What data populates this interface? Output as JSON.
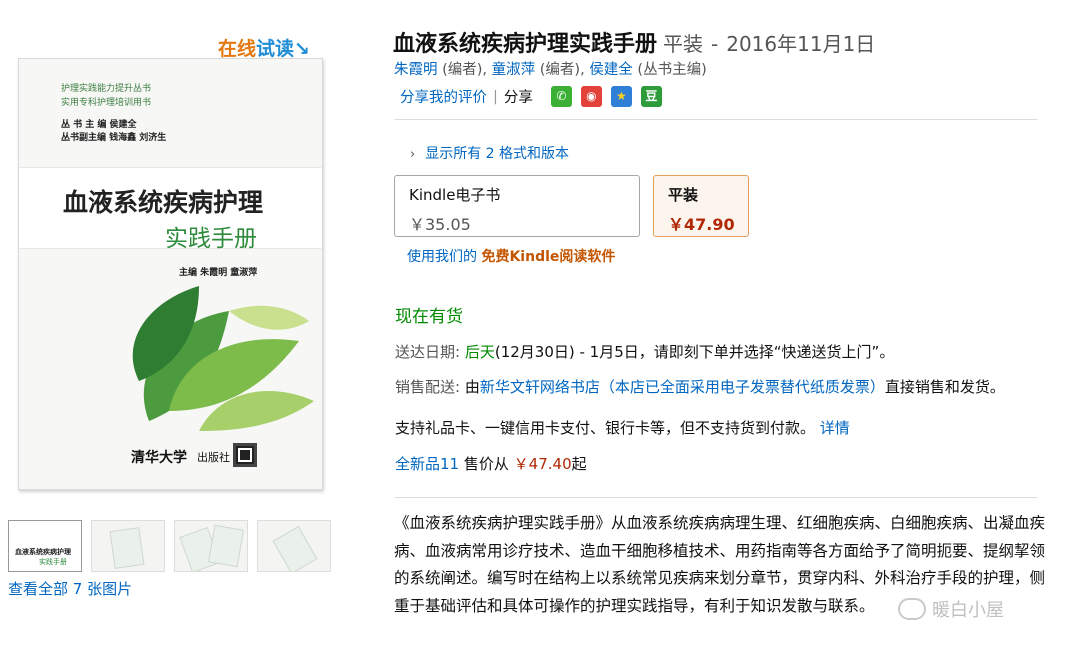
{
  "trial_read": {
    "part1": "在线",
    "part2": "试读",
    "arrow": "↘"
  },
  "cover": {
    "series_line1": "护理实践能力提升丛书",
    "series_line2": "实用专科护理培训用书",
    "editor_line1": "丛 书 主 编    侯建全",
    "editor_line2": "丛书副主编    钱海鑫    刘济生",
    "title_line1": "血液系统疾病护理",
    "title_line2": "实践手册",
    "authors": "主编    朱霞明    童淑萍",
    "publisher_logo": "清华大学",
    "publisher_suffix": "出版社"
  },
  "thumbnails": {
    "mini_title1": "血液系统疾病护理",
    "mini_title2": "实践手册",
    "see_all": "查看全部 7 张图片"
  },
  "product": {
    "title": "血液系统疾病护理实践手册",
    "format": "平装",
    "separator": "-",
    "date": "2016年11月1日",
    "authors": [
      {
        "name": "朱霞明",
        "role": "(编者),"
      },
      {
        "name": "童淑萍",
        "role": "(编者),"
      },
      {
        "name": "侯建全",
        "role": "(丛书主编)"
      }
    ]
  },
  "share": {
    "review_link": "分享我的评价",
    "divider": "|",
    "share_label": "分享",
    "icons": {
      "wechat": "wechat-icon",
      "weibo": "weibo-icon",
      "star": "star-icon",
      "douban": "douban-icon"
    },
    "douban_glyph": "豆",
    "star_glyph": "★",
    "weibo_glyph": "◉",
    "wechat_glyph": "✆"
  },
  "formats": {
    "show_all": "显示所有 2 格式和版本",
    "options": [
      {
        "name": "Kindle电子书",
        "price": "￥35.05",
        "selected": false
      },
      {
        "name": "平装",
        "price": "￥47.90",
        "selected": true
      }
    ]
  },
  "kindle_app": {
    "prefix": "使用我们的",
    "link": "免费Kindle阅读软件"
  },
  "availability": "现在有货",
  "delivery": {
    "label": "送达日期:",
    "day": "后天",
    "text": "(12月30日) - 1月5日，请即刻下单并选择“快递送货上门”。"
  },
  "seller": {
    "label": "销售配送:",
    "prefix": "由",
    "name": "新华文轩网络书店（本店已全面采用电子发票替代纸质发票）",
    "suffix": "直接销售和发货。"
  },
  "payment": {
    "text": "支持礼品卡、一键信用卡支付、银行卡等，但不支持货到付款。",
    "details": "详情"
  },
  "offers": {
    "link": "全新品11",
    "text": "售价从",
    "price": "￥47.40",
    "suffix": "起"
  },
  "description": "《血液系统疾病护理实践手册》从血液系统疾病病理生理、红细胞疾病、白细胞疾病、出凝血疾病、血液病常用诊疗技术、造血干细胞移植技术、用药指南等各方面给予了简明扼要、提纲挈领的系统阐述。编写时在结构上以系统常见疾病来划分章节，贯穿内科、外科治疗手段的护理，侧重于基础评估和具体可操作的护理实践指导，有利于知识发散与联系。",
  "watermark": "暖白小屋",
  "colors": {
    "link": "#0066c0",
    "price": "#b12704",
    "in_stock": "#008a00",
    "accent_orange": "#e47911"
  }
}
